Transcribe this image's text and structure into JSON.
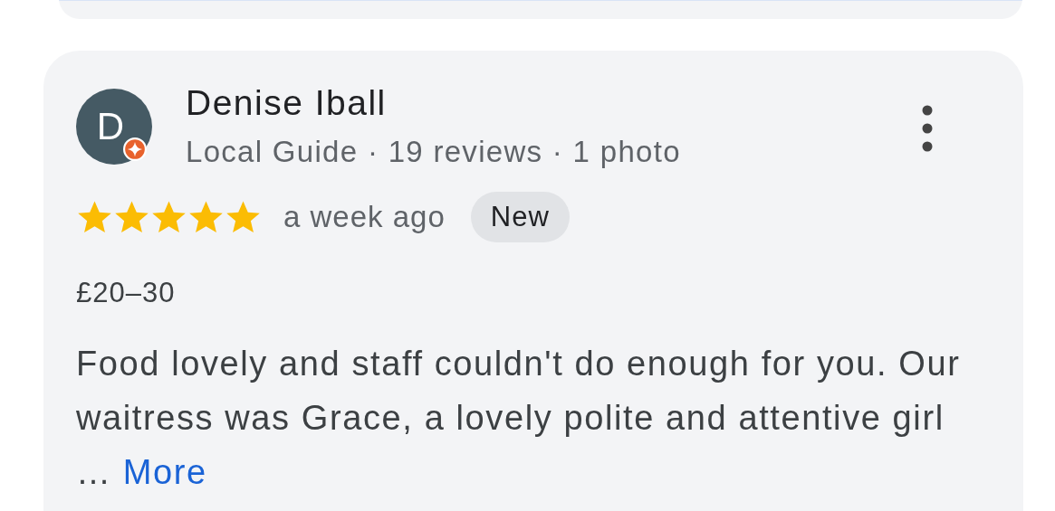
{
  "review": {
    "avatar_letter": "D",
    "local_guide_badge": true,
    "reviewer_name": "Denise Iball",
    "reviewer_meta": "Local Guide · 19 reviews · 1 photo",
    "stars": 5,
    "time": "a week ago",
    "tag": "New",
    "price": "£20–30",
    "text": "Food lovely and staff couldn't do enough for you. Our waitress was Grace, a lovely polite and attentive girl",
    "ellipsis": "…",
    "more_link": "More"
  }
}
